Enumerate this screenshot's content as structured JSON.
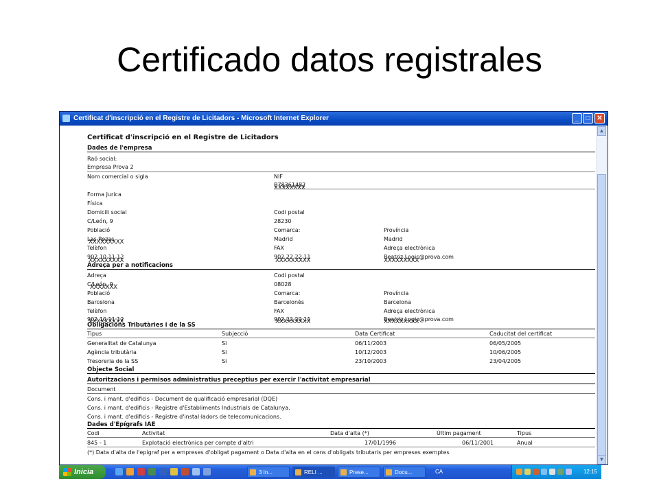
{
  "slide": {
    "title": "Certificado datos registrales"
  },
  "window": {
    "title": "Certificat d'inscripció en el Registre de Licitadors - Microsoft Internet Explorer",
    "min": "_",
    "max": "□",
    "close": "✕"
  },
  "doc": {
    "title": "Certificat d'inscripció en el Registre de Licitadors",
    "empresa": {
      "header": "Dades de l'empresa",
      "rao_label": "Raó social:",
      "rao_value": "Empresa Prova 2",
      "nom_label": "Nom comercial o sigla",
      "nif_label": "NIF",
      "nif_value": "B78361482",
      "forma_label": "Forma Jurica",
      "forma_value": "Física",
      "domicili_label": "Domicili social",
      "domicili_value": "C/León, 9",
      "codi_label": "Codi postal",
      "codi_value": "28230",
      "poblacio_label": "Població",
      "poblacio_value": "Las Rozas",
      "comarca_label": "Comarca:",
      "comarca_value": "Madrid",
      "provincia_label": "Província",
      "provincia_value": "Madrid",
      "telefon_label": "Telèfon",
      "telefon_value": "902 10 11 12",
      "fax_label": "FAX",
      "fax_value": "902 22 22 11",
      "email_label": "Adreça electrònica",
      "email_value": "Beatriz.Logic@prova.com"
    },
    "notificacions": {
      "header": "Adreça per a notificacions",
      "adreca_label": "Adreça",
      "adreca_value": "C/León, 9",
      "codi_label": "Codi postal",
      "codi_value": "08028",
      "poblacio_label": "Població",
      "poblacio_value": "Barcelona",
      "comarca_label": "Comarca:",
      "comarca_value": "Barcelonès",
      "provincia_label": "Província",
      "provincia_value": "Barcelona",
      "telefon_label": "Telèfon",
      "telefon_value": "902 10 11 12",
      "fax_label": "FAX",
      "fax_value": "902 22 22 11",
      "email_label": "Adreça electrònica",
      "email_value": "Beatriz.Logic@prova.com"
    },
    "obligacions": {
      "header": "Obligacions Tributàries i de la SS",
      "columns": [
        "Tipus",
        "Subjecció",
        "Data Certificat",
        "Caducitat del certificat"
      ],
      "rows": [
        [
          "Generalitat de Catalunya",
          "Si",
          "06/11/2003",
          "06/05/2005"
        ],
        [
          "Agència tributària",
          "Si",
          "10/12/2003",
          "10/06/2005"
        ],
        [
          "Tresoreria de la SS",
          "Si",
          "23/10/2003",
          "23/04/2005"
        ]
      ]
    },
    "objecte": {
      "header": "Objecte Social"
    },
    "autoritzacions": {
      "header": "Autoritzacions i permisos administratius preceptius per exercir l'activitat empresarial",
      "col": "Document",
      "rows": [
        "Cons. i mant. d'edificis - Document de qualificació empresarial (DQE)",
        "Cons. i mant. d'edificis - Registre d'Establiments Industrials de Catalunya.",
        "Cons. i mant. d'edificis - Registre d'instal·ladors de telecomunicacions."
      ]
    },
    "iae": {
      "header": "Dades d'Epígrafs IAE",
      "columns": [
        "Codi",
        "Activitat",
        "Data d'alta (*)",
        "Últim pagament",
        "Tipus"
      ],
      "row": [
        "845 - 1",
        "Explotació electrònica per compte d'altri",
        "17/01/1996",
        "06/11/2001",
        "Anual"
      ],
      "note": "(*) Data d'alta de l'epígraf per a empreses d'obligat pagament o Data d'alta en el cens d'obligats tributaris per empreses exemptes"
    },
    "redactions": {
      "x7": "XXXXXXX",
      "x8": "XXXXXXXX",
      "x9": "XXXXXXXXX"
    }
  },
  "taskbar": {
    "start": "Inicia",
    "items": [
      "3 In...",
      "RELI ...",
      "Prese...",
      "Docu...",
      "CA"
    ],
    "clock": "12:15"
  }
}
